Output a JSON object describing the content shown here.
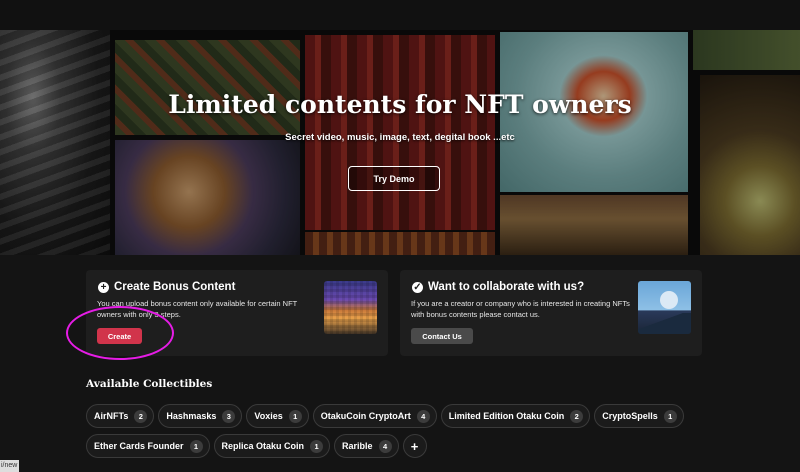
{
  "hero": {
    "title": "Limited contents for NFT owners",
    "subtitle": "Secret video, music, image, text, degital book ...etc",
    "demo_button": "Try Demo"
  },
  "create_card": {
    "title": "Create Bonus Content",
    "description": "You can upload bonus content only available for certain NFT owners with only 3 steps.",
    "button": "Create",
    "icon": "plus-circle-icon"
  },
  "collab_card": {
    "title": "Want to collaborate with us?",
    "description": "If you are a creator or company who is interested in creating NFTs with bonus contents please contact us.",
    "button": "Contact Us",
    "icon": "check-circle-icon"
  },
  "collectibles": {
    "title": "Available Collectibles",
    "items": [
      {
        "label": "AirNFTs",
        "count": "2"
      },
      {
        "label": "Hashmasks",
        "count": "3"
      },
      {
        "label": "Voxies",
        "count": "1"
      },
      {
        "label": "OtakuCoin CryptoArt",
        "count": "4"
      },
      {
        "label": "Limited Edition Otaku Coin",
        "count": "2"
      },
      {
        "label": "CryptoSpells",
        "count": "1"
      },
      {
        "label": "Ether Cards Founder",
        "count": "1"
      },
      {
        "label": "Replica Otaku Coin",
        "count": "1"
      },
      {
        "label": "Rarible",
        "count": "4"
      }
    ],
    "add_label": "+"
  },
  "status_bar": {
    "url_fragment": "i/new"
  },
  "colors": {
    "background": "#141414",
    "card": "#1e1e1e",
    "create_button": "#d1344b",
    "contact_button": "#4a4a4a",
    "annotation": "#e61ce6"
  }
}
